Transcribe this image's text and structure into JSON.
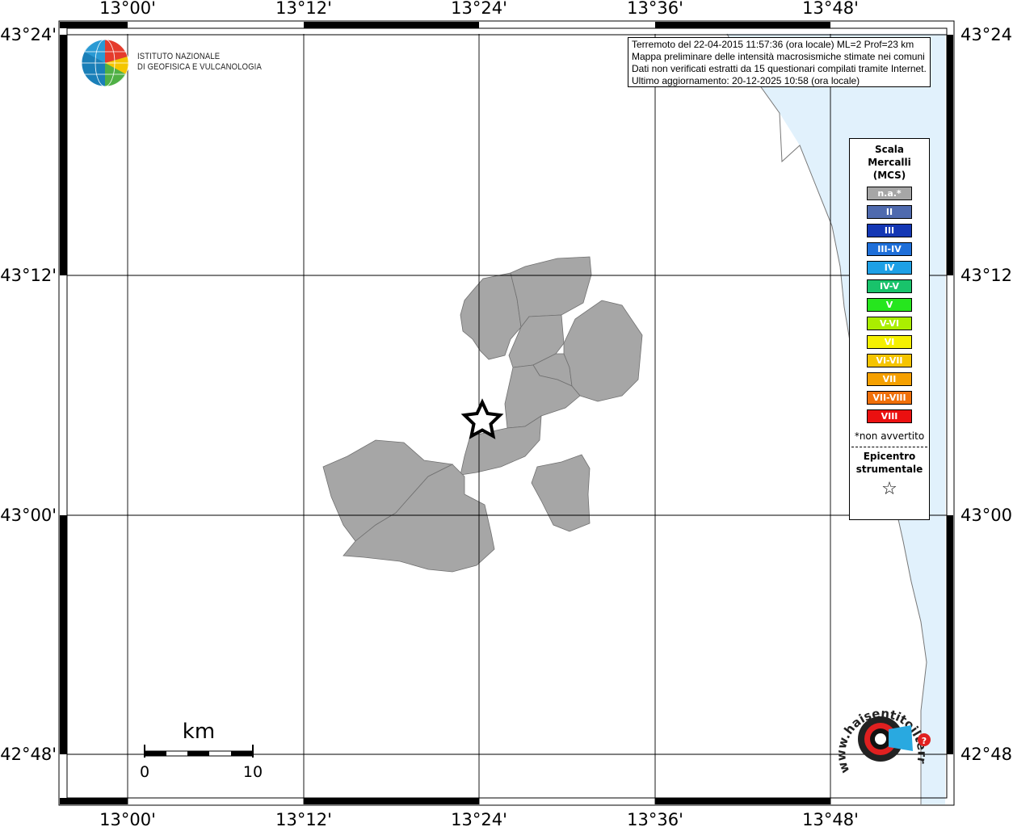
{
  "lon_labels": [
    "13°00'",
    "13°12'",
    "13°24'",
    "13°36'",
    "13°48'"
  ],
  "lat_labels": [
    "43°24'",
    "43°12'",
    "43°00'",
    "42°48'"
  ],
  "info": {
    "line1": "Terremoto del 22-04-2015 11:57:36 (ora locale) ML=2 Prof=23 km",
    "line2": "Mappa preliminare delle intensità macrosismiche stimate nei comuni",
    "line3": "Dati non verificati estratti da 15 questionari compilati tramite Internet.",
    "line4": "Ultimo aggiornamento: 20-12-2025 10:58 (ora locale)"
  },
  "institute": {
    "line1": "ISTITUTO NAZIONALE",
    "line2": "DI GEOFISICA E VULCANOLOGIA"
  },
  "legend": {
    "title1": "Scala",
    "title2": "Mercalli",
    "title3": "(MCS)",
    "classes": [
      {
        "label": "n.a.*",
        "color": "#a6a6a6"
      },
      {
        "label": "II",
        "color": "#4f6aae"
      },
      {
        "label": "III",
        "color": "#1437b4"
      },
      {
        "label": "III-IV",
        "color": "#1e6fd9"
      },
      {
        "label": "IV",
        "color": "#1ea0e6"
      },
      {
        "label": "IV-V",
        "color": "#19c36b"
      },
      {
        "label": "V",
        "color": "#26e61e"
      },
      {
        "label": "V-VI",
        "color": "#aaee00"
      },
      {
        "label": "VI",
        "color": "#f5f000"
      },
      {
        "label": "VI-VII",
        "color": "#f5c400"
      },
      {
        "label": "VII",
        "color": "#f5a000"
      },
      {
        "label": "VII-VIII",
        "color": "#f0700a"
      },
      {
        "label": "VIII",
        "color": "#eb1010"
      }
    ],
    "note": "*non avvertito",
    "epi1": "Epicentro",
    "epi2": "strumentale",
    "star": "☆"
  },
  "scale_bar": {
    "unit": "km",
    "min": "0",
    "max": "10"
  },
  "haisentito_logo": "www.haisentitoilterremoto.it",
  "colors": {
    "municipality": "#a6a6a6",
    "sea": "#e1f1fc",
    "grid": "#000000"
  }
}
